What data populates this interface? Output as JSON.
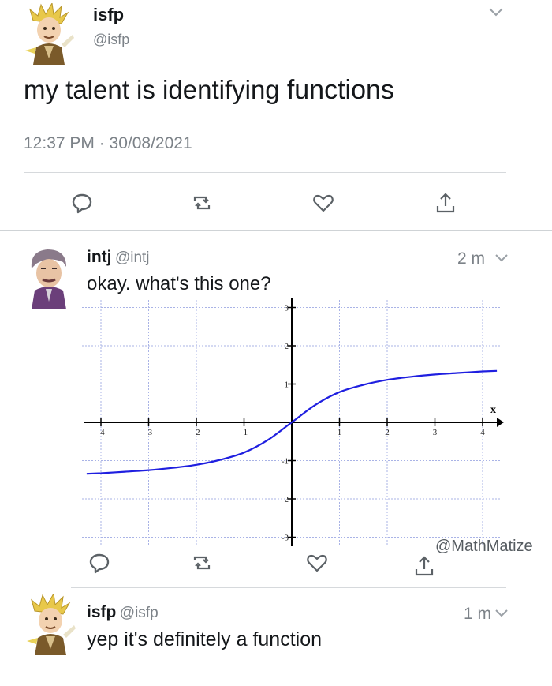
{
  "tweet1": {
    "name": "isfp",
    "handle": "@isfp",
    "text_pre": "my talent is identifying ",
    "text_bold": "functions",
    "timestamp": "12:37 PM · 30/08/2021"
  },
  "reply1": {
    "name": "intj",
    "handle": "@intj",
    "time": "2 m",
    "text": "okay. what's this one?"
  },
  "reply2": {
    "name": "isfp",
    "handle": "@isfp",
    "time": "1 m",
    "text_pre": "yep it's definitely a ",
    "text_bold": "function"
  },
  "watermark": "@MathMatize",
  "icons": [
    "reply-icon",
    "retweet-icon",
    "like-icon",
    "share-icon",
    "chevron-down-icon"
  ],
  "colors": {
    "curve": "#1f1fe0",
    "grid": "#a9b3e6",
    "handle": "#7c8288"
  },
  "chart_data": {
    "type": "line",
    "title": "",
    "xlabel": "x",
    "ylabel": "",
    "xlim": [
      -4.3,
      4.3
    ],
    "ylim": [
      -3.2,
      3.2
    ],
    "x_ticks": [
      "-4",
      "-3",
      "-2",
      "-1",
      "1",
      "2",
      "3",
      "4"
    ],
    "y_ticks": [
      "-3",
      "-2",
      "-1",
      "1",
      "2",
      "3"
    ],
    "grid": true,
    "series": [
      {
        "x": [
          -4,
          -3.5,
          -3,
          -2.5,
          -2,
          -1.5,
          -1,
          -0.5,
          0,
          0.5,
          1,
          1.5,
          2,
          2.5,
          3,
          3.5,
          4
        ],
        "y": [
          -1.33,
          -1.29,
          -1.25,
          -1.19,
          -1.11,
          -0.98,
          -0.79,
          -0.46,
          0,
          0.46,
          0.79,
          0.98,
          1.11,
          1.19,
          1.25,
          1.29,
          1.33
        ]
      }
    ]
  }
}
